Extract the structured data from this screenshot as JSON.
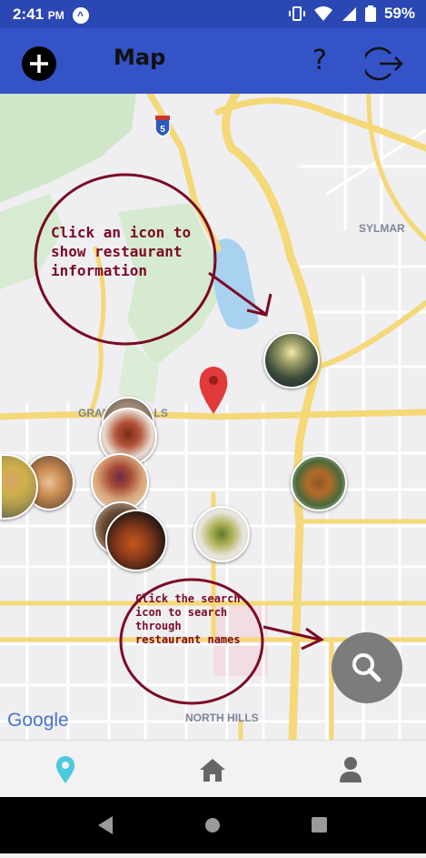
{
  "status_bar": {
    "time": "2:41",
    "ampm": "PM",
    "battery": "59%"
  },
  "app_bar": {
    "title": "Map",
    "help_label": "?"
  },
  "map": {
    "place_labels": [
      "SYLMAR",
      "GRANADA HILLS",
      "NORTH HILLS"
    ],
    "highway_shield": "5",
    "attribution": "Google"
  },
  "annotations": {
    "icon_hint": [
      "Click an icon to",
      "show restaurant",
      "information"
    ],
    "search_hint": [
      "Click the search",
      "icon to search",
      "through",
      "restaurant names"
    ]
  },
  "colors": {
    "app_bar": "#3353c7",
    "status_bar": "#2b47b4",
    "annotation": "#7b0a25",
    "nav_active": "#4cc9dd",
    "nav_inactive": "#666666"
  },
  "icons": {
    "add": "plus-circle-icon",
    "help": "question-mark-icon",
    "logout": "logout-icon",
    "search": "search-icon",
    "nav_map": "map-pin-icon",
    "nav_home": "home-icon",
    "nav_profile": "user-icon"
  }
}
